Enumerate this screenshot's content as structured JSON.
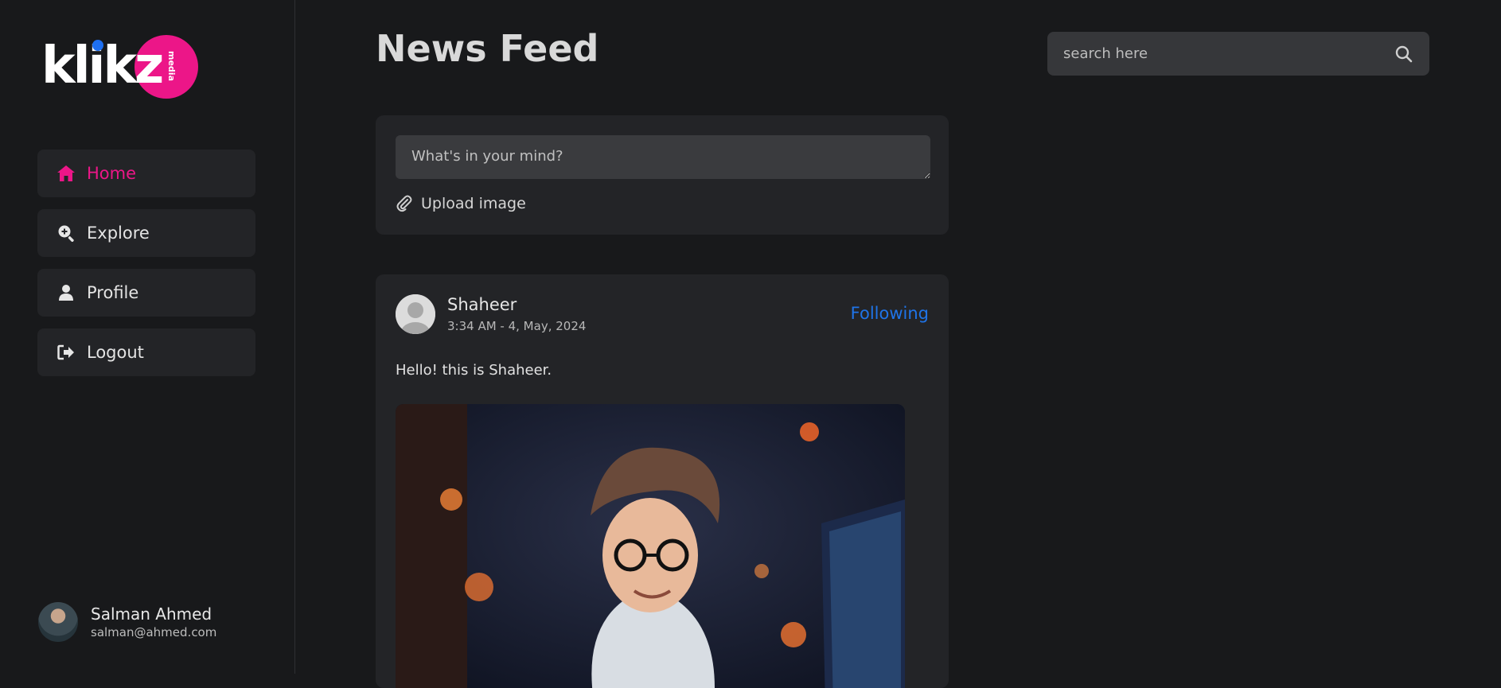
{
  "brand": {
    "logo_text": "klikz",
    "logo_sub": "media",
    "colors": {
      "accent": "#ec1688",
      "link": "#1f74e8",
      "background": "#18191b",
      "card": "#232427"
    }
  },
  "sidebar": {
    "items": [
      {
        "label": "Home",
        "icon": "home-icon",
        "active": true
      },
      {
        "label": "Explore",
        "icon": "search-plus-icon",
        "active": false
      },
      {
        "label": "Profile",
        "icon": "user-icon",
        "active": false
      },
      {
        "label": "Logout",
        "icon": "logout-icon",
        "active": false
      }
    ],
    "user": {
      "name": "Salman Ahmed",
      "email": "salman@ahmed.com"
    }
  },
  "header": {
    "title": "News Feed"
  },
  "search": {
    "placeholder": "search here",
    "icon": "search-icon"
  },
  "composer": {
    "placeholder": "What's in your mind?",
    "upload_label": "Upload image",
    "upload_icon": "paperclip-icon"
  },
  "post": {
    "author": "Shaheer",
    "time": "3:34 AM - 4, May, 2024",
    "follow_label": "Following",
    "text": "Hello! this is Shaheer."
  }
}
